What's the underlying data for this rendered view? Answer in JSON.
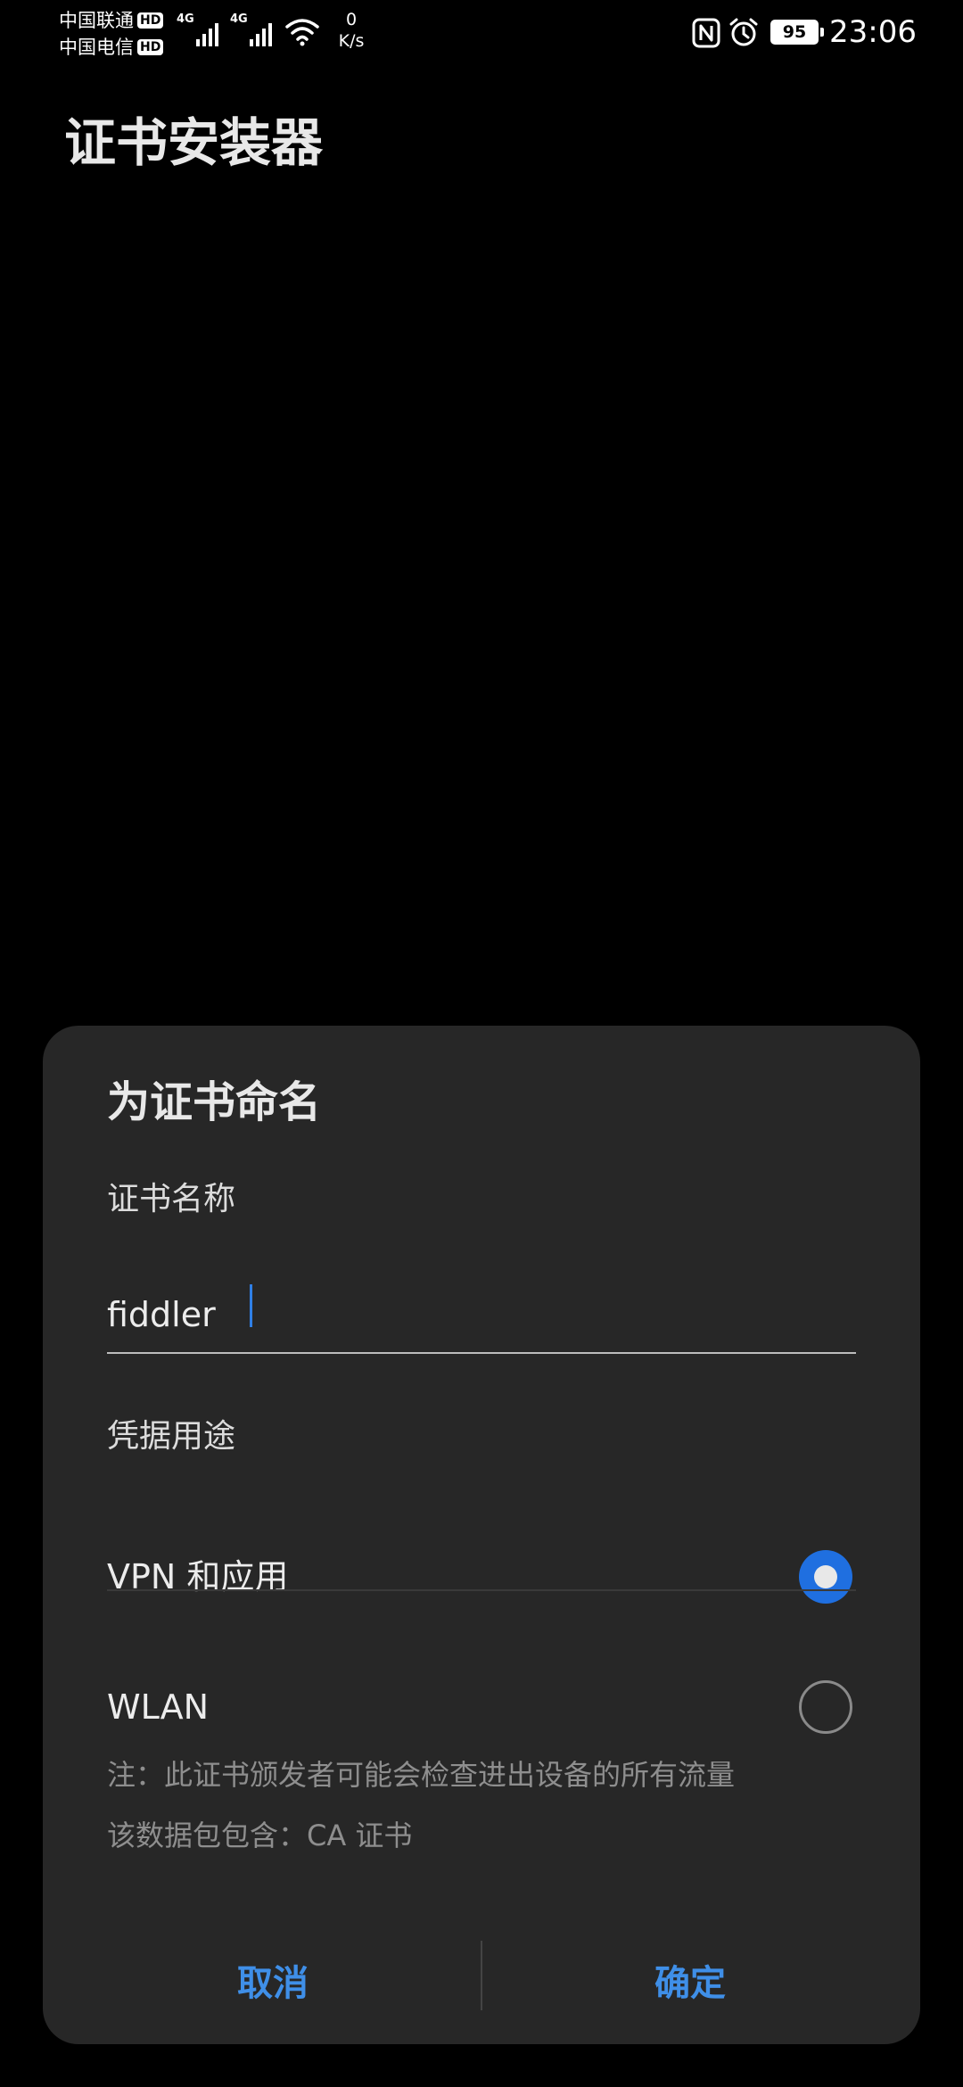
{
  "status_bar": {
    "carrier_1": "中国联通",
    "carrier_2": "中国电信",
    "hd_label": "HD",
    "network_type": "4G",
    "net_speed_value": "0",
    "net_speed_unit": "K/s",
    "battery_level": "95",
    "time": "23:06"
  },
  "app": {
    "title": "证书安装器"
  },
  "dialog": {
    "title": "为证书命名",
    "name_label": "证书名称",
    "name_value": "fiddler",
    "usage_label": "凭据用途",
    "options": [
      {
        "label": "VPN 和应用",
        "selected": true
      },
      {
        "label": "WLAN",
        "selected": false
      }
    ],
    "note_line1": "注：此证书颁发者可能会检查进出设备的所有流量",
    "note_line2": "该数据包包含：CA 证书",
    "cancel_label": "取消",
    "confirm_label": "确定"
  },
  "colors": {
    "accent": "#1f6fe0",
    "button_text": "#3f8fe8",
    "dialog_bg": "#272727",
    "screen_bg": "#000000"
  }
}
